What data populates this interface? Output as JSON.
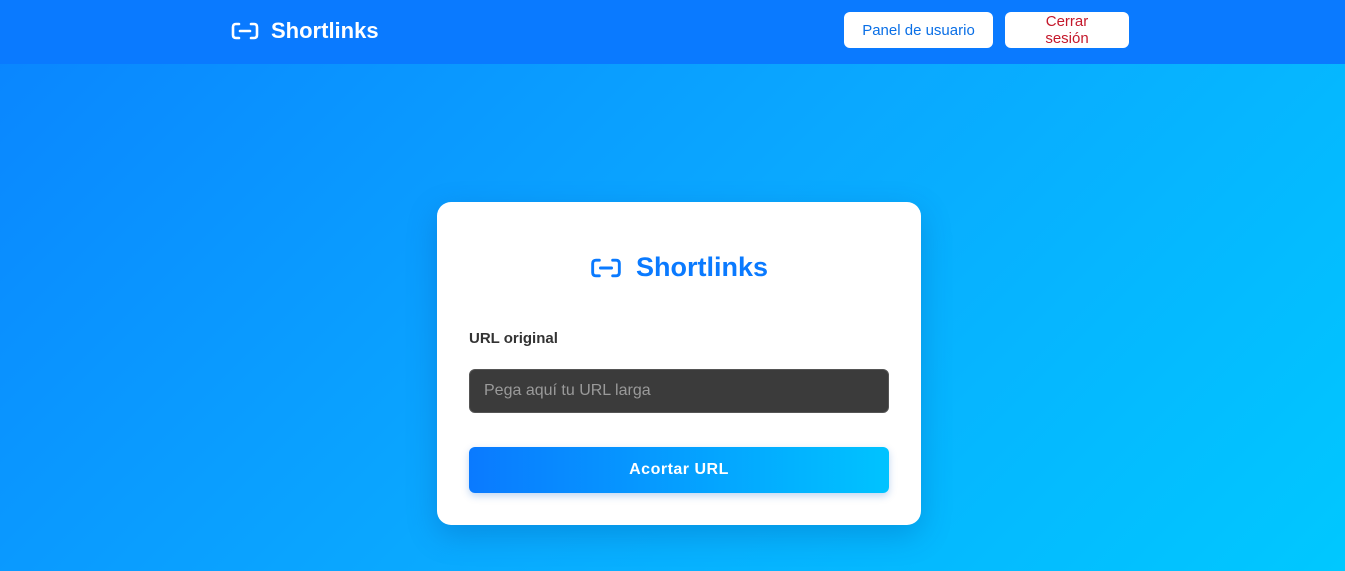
{
  "navbar": {
    "brand": "Shortlinks",
    "brand_icon": "link-icon",
    "panel_label": "Panel de usuario",
    "logout_label": "Cerrar sesión"
  },
  "card": {
    "brand": "Shortlinks",
    "brand_icon": "link-icon",
    "url_label": "URL original",
    "url_value": "",
    "url_placeholder": "Pega aquí tu URL larga",
    "submit_label": "Acortar URL"
  },
  "colors": {
    "primary": "#0a7aff",
    "accent": "#00c3ff",
    "danger": "#c4182b",
    "input_bg": "#3b3b3b"
  }
}
